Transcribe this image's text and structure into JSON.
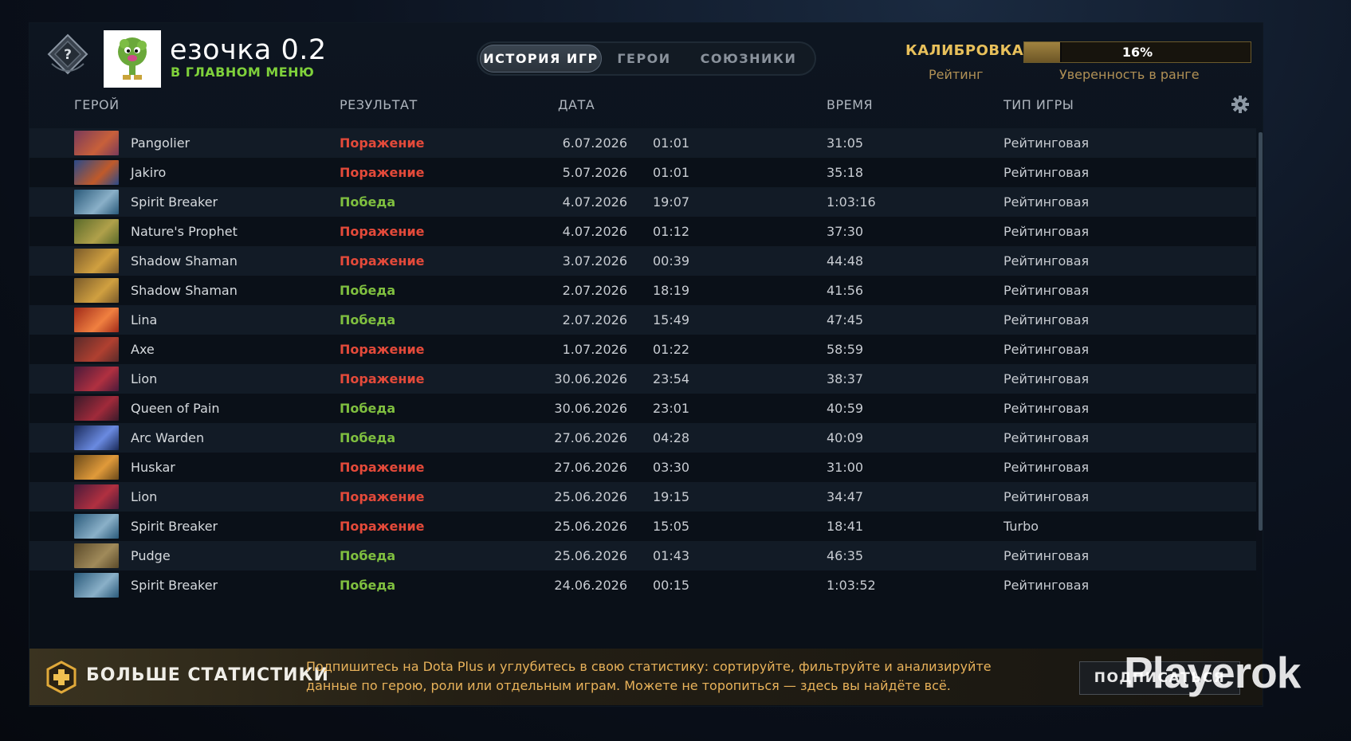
{
  "player": {
    "name": "езочка 0.2",
    "status": "В ГЛАВНОМ МЕНЮ"
  },
  "tabs": [
    {
      "label": "ИСТОРИЯ ИГР",
      "active": true
    },
    {
      "label": "ГЕРОИ",
      "active": false
    },
    {
      "label": "СОЮЗНИКИ",
      "active": false
    }
  ],
  "calibration": {
    "label": "КАЛИБРОВКА",
    "rating_label": "Рейтинг",
    "confidence_label": "Уверенность в ранге",
    "progress_text": "16%",
    "progress_fraction": 0.16
  },
  "table": {
    "headers": {
      "hero": "ГЕРОЙ",
      "result": "РЕЗУЛЬТАТ",
      "date": "ДАТА",
      "time": "ВРЕМЯ",
      "mode": "ТИП ИГРЫ"
    },
    "rows": [
      {
        "hero": "Pangolier",
        "result": "Поражение",
        "win": false,
        "date": "6.07.2026",
        "tod": "01:01",
        "duration": "31:05",
        "mode": "Рейтинговая"
      },
      {
        "hero": "Jakiro",
        "result": "Поражение",
        "win": false,
        "date": "5.07.2026",
        "tod": "01:01",
        "duration": "35:18",
        "mode": "Рейтинговая"
      },
      {
        "hero": "Spirit Breaker",
        "result": "Победа",
        "win": true,
        "date": "4.07.2026",
        "tod": "19:07",
        "duration": "1:03:16",
        "mode": "Рейтинговая"
      },
      {
        "hero": "Nature's Prophet",
        "result": "Поражение",
        "win": false,
        "date": "4.07.2026",
        "tod": "01:12",
        "duration": "37:30",
        "mode": "Рейтинговая"
      },
      {
        "hero": "Shadow Shaman",
        "result": "Поражение",
        "win": false,
        "date": "3.07.2026",
        "tod": "00:39",
        "duration": "44:48",
        "mode": "Рейтинговая"
      },
      {
        "hero": "Shadow Shaman",
        "result": "Победа",
        "win": true,
        "date": "2.07.2026",
        "tod": "18:19",
        "duration": "41:56",
        "mode": "Рейтинговая"
      },
      {
        "hero": "Lina",
        "result": "Победа",
        "win": true,
        "date": "2.07.2026",
        "tod": "15:49",
        "duration": "47:45",
        "mode": "Рейтинговая"
      },
      {
        "hero": "Axe",
        "result": "Поражение",
        "win": false,
        "date": "1.07.2026",
        "tod": "01:22",
        "duration": "58:59",
        "mode": "Рейтинговая"
      },
      {
        "hero": "Lion",
        "result": "Поражение",
        "win": false,
        "date": "30.06.2026",
        "tod": "23:54",
        "duration": "38:37",
        "mode": "Рейтинговая"
      },
      {
        "hero": "Queen of Pain",
        "result": "Победа",
        "win": true,
        "date": "30.06.2026",
        "tod": "23:01",
        "duration": "40:59",
        "mode": "Рейтинговая"
      },
      {
        "hero": "Arc Warden",
        "result": "Победа",
        "win": true,
        "date": "27.06.2026",
        "tod": "04:28",
        "duration": "40:09",
        "mode": "Рейтинговая"
      },
      {
        "hero": "Huskar",
        "result": "Поражение",
        "win": false,
        "date": "27.06.2026",
        "tod": "03:30",
        "duration": "31:00",
        "mode": "Рейтинговая"
      },
      {
        "hero": "Lion",
        "result": "Поражение",
        "win": false,
        "date": "25.06.2026",
        "tod": "19:15",
        "duration": "34:47",
        "mode": "Рейтинговая"
      },
      {
        "hero": "Spirit Breaker",
        "result": "Поражение",
        "win": false,
        "date": "25.06.2026",
        "tod": "15:05",
        "duration": "18:41",
        "mode": "Turbo"
      },
      {
        "hero": "Pudge",
        "result": "Победа",
        "win": true,
        "date": "25.06.2026",
        "tod": "01:43",
        "duration": "46:35",
        "mode": "Рейтинговая"
      },
      {
        "hero": "Spirit Breaker",
        "result": "Победа",
        "win": true,
        "date": "24.06.2026",
        "tod": "00:15",
        "duration": "1:03:52",
        "mode": "Рейтинговая"
      }
    ]
  },
  "colors": {
    "win": "#7fbf3f",
    "loss": "#e44a3a",
    "accent": "#e8c05b",
    "status_green": "#7fd13b",
    "promo": "#e8b25a"
  },
  "footer": {
    "title": "БОЛЬШЕ СТАТИСТИКИ",
    "text": "Подпишитесь на Dota Plus и углубитесь в свою статистику: сортируйте, фильтруйте и анализируйте данные по герою, роли или отдельным играм. Можете не торопиться — здесь вы найдёте всё.",
    "button": "ПОДПИСАТЬСЯ"
  },
  "watermark": "Playerok",
  "icons": {
    "rank": "rank-unknown-icon",
    "settings": "gear-icon",
    "plus": "dota-plus-icon"
  }
}
